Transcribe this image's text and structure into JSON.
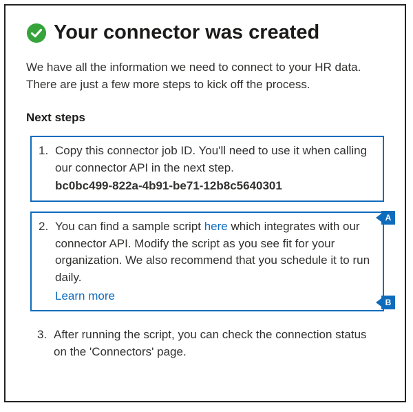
{
  "header": {
    "title": "Your connector was created"
  },
  "intro": "We have all the information we need to connect to your HR data. There are just a few more steps to kick off the process.",
  "next_steps_label": "Next steps",
  "steps": {
    "s1": {
      "text": "Copy this connector job ID. You'll need to use it when calling our connector API in the next step.",
      "job_id": "bc0bc499-822a-4b91-be71-12b8c5640301"
    },
    "s2": {
      "pre": "You can find a sample script ",
      "here": "here",
      "mid": " which integrates with our connector API. Modify the script as you see fit for your organization. We also recommend that you schedule it to run daily.",
      "learn_more": "Learn more"
    },
    "s3": {
      "text": "After running the script, you can check the connection status on the 'Connectors' page."
    }
  },
  "callouts": {
    "a": "A",
    "b": "B"
  }
}
